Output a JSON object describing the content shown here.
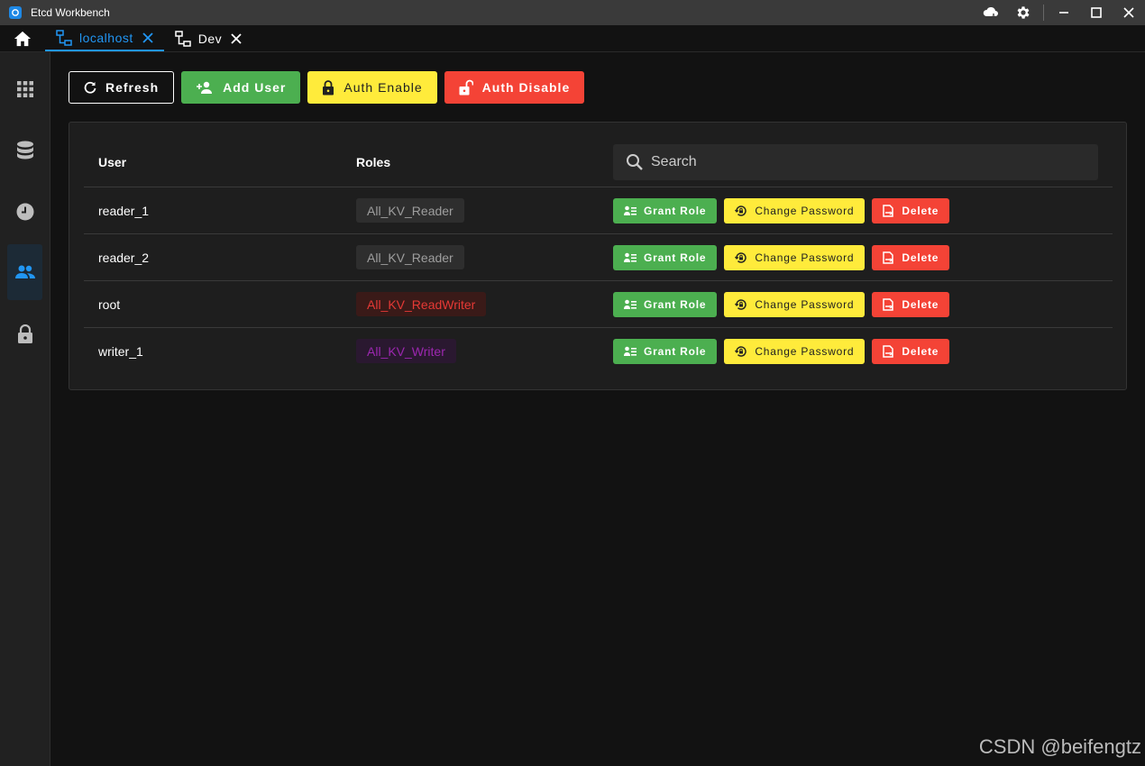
{
  "app": {
    "title": "Etcd Workbench"
  },
  "tabs": [
    {
      "label": "localhost",
      "active": true
    },
    {
      "label": "Dev",
      "active": false
    }
  ],
  "toolbar": {
    "refresh_label": "Refresh",
    "add_user_label": "Add User",
    "auth_enable_label": "Auth Enable",
    "auth_disable_label": "Auth Disable"
  },
  "table": {
    "headers": {
      "user": "User",
      "roles": "Roles"
    },
    "search_placeholder": "Search",
    "rows": [
      {
        "user": "reader_1",
        "role": "All_KV_Reader",
        "role_kind": "reader"
      },
      {
        "user": "reader_2",
        "role": "All_KV_Reader",
        "role_kind": "reader"
      },
      {
        "user": "root",
        "role": "All_KV_ReadWriter",
        "role_kind": "readwriter"
      },
      {
        "user": "writer_1",
        "role": "All_KV_Writer",
        "role_kind": "writer"
      }
    ],
    "actions": {
      "grant_role": "Grant Role",
      "change_password": "Change Password",
      "delete": "Delete"
    }
  },
  "watermark": "CSDN @beifengtz",
  "colors": {
    "accent": "#2196f3",
    "success": "#4caf50",
    "warning": "#ffeb3b",
    "danger": "#f44336",
    "role_reader_bg": "#2e2e2e",
    "role_reader_fg": "#9e9e9e",
    "role_readwriter_bg": "#3a1a18",
    "role_readwriter_fg": "#e53935",
    "role_writer_bg": "#2a1830",
    "role_writer_fg": "#9c27b0"
  }
}
